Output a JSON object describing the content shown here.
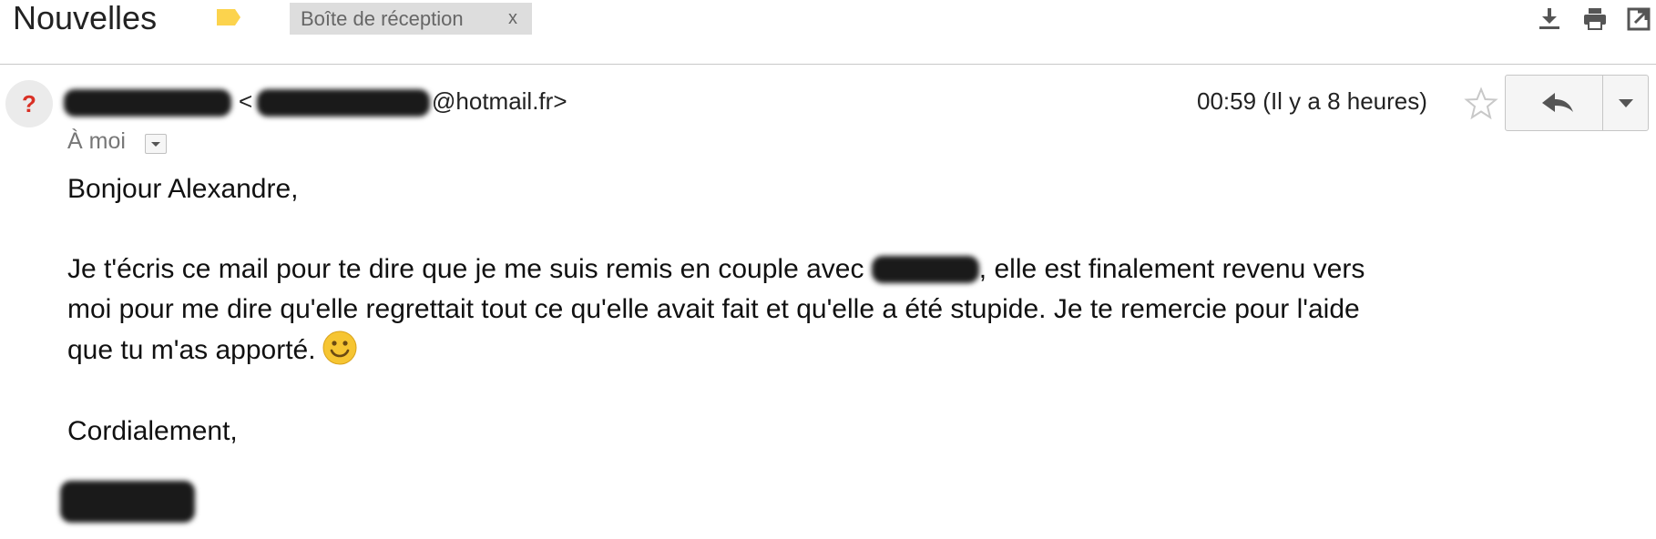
{
  "header": {
    "subject": "Nouvelles",
    "label_color": "#fcd34d",
    "inbox_chip": {
      "label": "Boîte de réception",
      "remove": "x"
    },
    "actions": [
      {
        "icon": "download-icon"
      },
      {
        "icon": "print-icon"
      },
      {
        "icon": "new-window-icon"
      }
    ]
  },
  "message": {
    "sender": {
      "avatar": "?",
      "email_suffix": "@hotmail.fr>",
      "open_bracket": "<"
    },
    "recipient": "À moi",
    "date": "00:59 (Il y a 8 heures)",
    "reply_icon": "reply-icon",
    "more_icon": "dropdown-arrow-icon",
    "star_icon": "star-outline-icon",
    "body": {
      "greeting": "Bonjour Alexandre,",
      "p1_before": "Je t'écris ce mail pour te dire que je me suis remis en couple avec ",
      "p1_after": ", elle est finalement revenu vers",
      "p1_line2": "moi pour me dire qu'elle regrettait tout ce qu'elle avait fait et qu'elle a été stupide. Je te remercie pour l'aide",
      "p1_line3": "que tu m'as apporté.",
      "closing": "Cordialement,"
    }
  },
  "colors": {
    "accent_red": "#d93025",
    "emoji_yellow": "#f6c532"
  }
}
